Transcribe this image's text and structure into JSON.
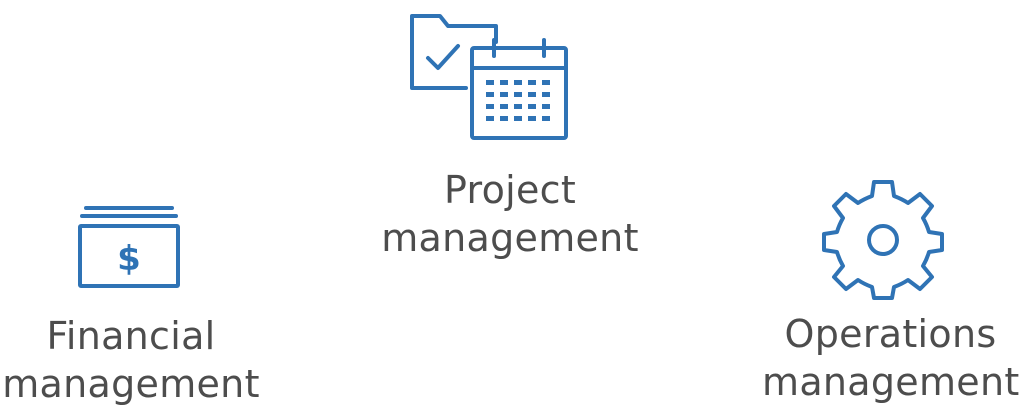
{
  "features": {
    "project": {
      "icon": "folder-calendar-icon",
      "label_line1": "Project",
      "label_line2": "management"
    },
    "financial": {
      "icon": "dollar-bill-stack-icon",
      "label_line1": "Financial",
      "label_line2": "management"
    },
    "operations": {
      "icon": "gear-icon",
      "label_line1": "Operations",
      "label_line2": "management"
    }
  },
  "colors": {
    "icon": "#2f73b5",
    "text": "#4d4d4d",
    "background": "#ffffff"
  }
}
